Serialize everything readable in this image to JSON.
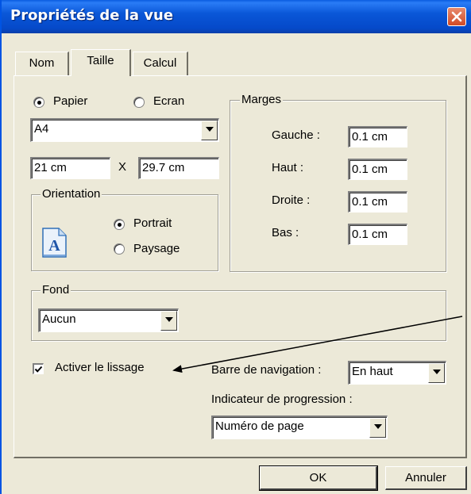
{
  "window": {
    "title": "Propriétés de la vue",
    "close_icon": "close-icon"
  },
  "tabs": [
    {
      "label": "Nom",
      "active": false
    },
    {
      "label": "Taille",
      "active": true
    },
    {
      "label": "Calcul",
      "active": false
    }
  ],
  "size": {
    "mode_options": [
      {
        "label": "Papier",
        "checked": true
      },
      {
        "label": "Ecran",
        "checked": false
      }
    ],
    "paper_select": "A4",
    "width_value": "21 cm",
    "times_symbol": "X",
    "height_value": "29.7 cm"
  },
  "orientation": {
    "legend": "Orientation",
    "icon": "document-a-icon",
    "icon_letter": "A",
    "options": [
      {
        "label": "Portrait",
        "checked": true
      },
      {
        "label": "Paysage",
        "checked": false
      }
    ]
  },
  "margins": {
    "legend": "Marges",
    "rows": [
      {
        "label": "Gauche :",
        "value": "0.1 cm"
      },
      {
        "label": "Haut :",
        "value": "0.1 cm"
      },
      {
        "label": "Droite :",
        "value": "0.1 cm"
      },
      {
        "label": "Bas :",
        "value": "0.1 cm"
      }
    ]
  },
  "background": {
    "legend": "Fond",
    "select": "Aucun"
  },
  "smoothing": {
    "label": "Activer le lissage",
    "checked": true
  },
  "navigation": {
    "label": "Barre de navigation :",
    "select": "En haut"
  },
  "progress": {
    "label": "Indicateur de progression :",
    "select": "Numéro de page"
  },
  "buttons": {
    "ok": "OK",
    "cancel": "Annuler"
  }
}
